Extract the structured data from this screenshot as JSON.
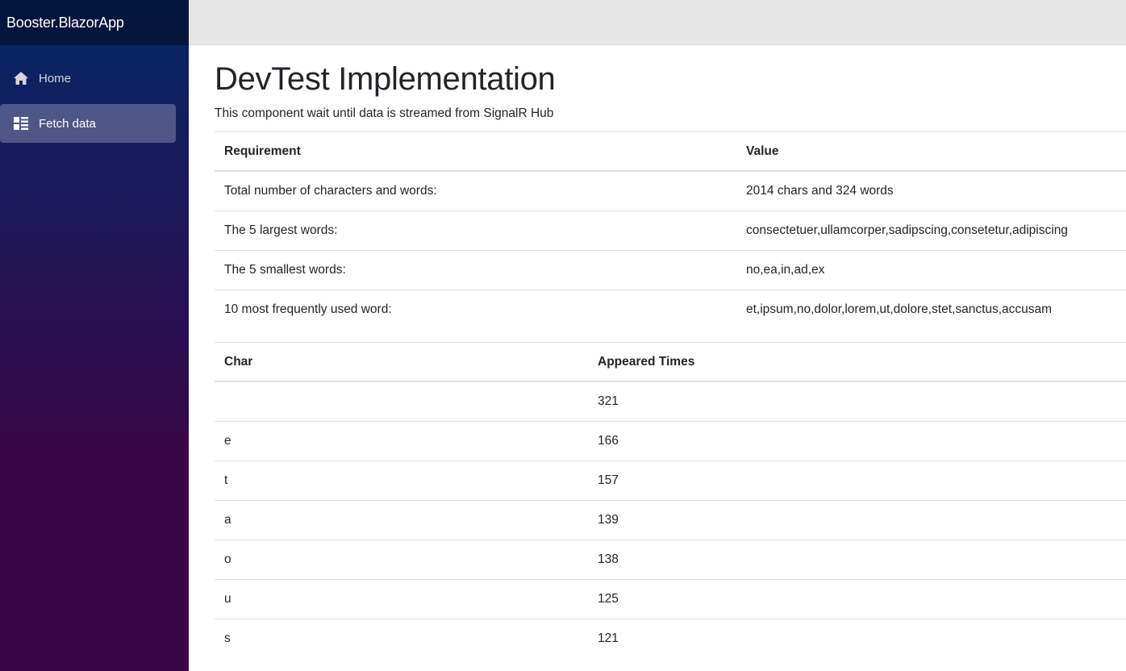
{
  "app": {
    "brand": "Booster.BlazorApp"
  },
  "sidebar": {
    "items": [
      {
        "label": "Home",
        "icon": "home-icon",
        "active": false
      },
      {
        "label": "Fetch data",
        "icon": "list-icon",
        "active": true
      }
    ]
  },
  "main": {
    "title": "DevTest Implementation",
    "subtitle": "This component wait until data is streamed from SignalR Hub",
    "requirements_table": {
      "headers": [
        "Requirement",
        "Value"
      ],
      "rows": [
        [
          "Total number of characters and words:",
          "2014 chars and 324 words"
        ],
        [
          "The 5 largest words:",
          "consectetuer,ullamcorper,sadipscing,consetetur,adipiscing"
        ],
        [
          "The 5 smallest words:",
          "no,ea,in,ad,ex"
        ],
        [
          "10 most frequently used word:",
          "et,ipsum,no,dolor,lorem,ut,dolore,stet,sanctus,accusam"
        ]
      ]
    },
    "char_table": {
      "headers": [
        "Char",
        "Appeared Times"
      ],
      "rows": [
        [
          " ",
          "321"
        ],
        [
          "e",
          "166"
        ],
        [
          "t",
          "157"
        ],
        [
          "a",
          "139"
        ],
        [
          "o",
          "138"
        ],
        [
          "u",
          "125"
        ],
        [
          "s",
          "121"
        ]
      ]
    }
  },
  "colors": {
    "sidebar_top": "#052767",
    "sidebar_bottom": "#3a0647",
    "top_row": "#e6e6e6"
  }
}
